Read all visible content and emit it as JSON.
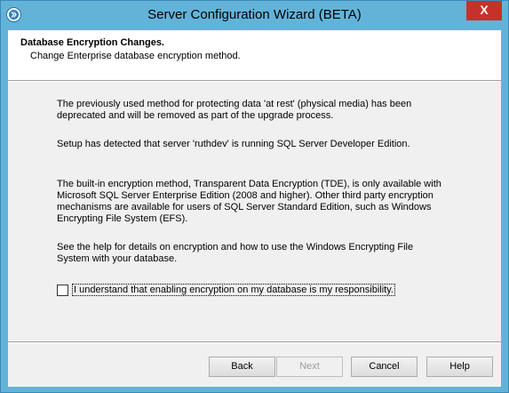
{
  "window": {
    "title": "Server Configuration Wizard (BETA)",
    "close_glyph": "X"
  },
  "header": {
    "title": "Database Encryption Changes.",
    "subtitle": "Change Enterprise database encryption method."
  },
  "body": {
    "paragraph1": "The previously used method for protecting data 'at rest' (physical media) has been deprecated and will be removed as part of the upgrade process.",
    "paragraph2": "Setup has detected that server 'ruthdev'  is running SQL Server Developer Edition.",
    "paragraph3": "The built-in encryption method, Transparent Data Encryption (TDE), is only available with Microsoft SQL Server Enterprise Edition (2008 and higher).  Other third party encryption mechanisms are available for users of SQL Server Standard Edition, such as Windows Encrypting File System (EFS).",
    "paragraph4": "See the help for details on encryption and how to use the Windows Encrypting File System with your database.",
    "checkbox_label": "I understand that enabling encryption on my database is my responsibility.",
    "checkbox_checked": false
  },
  "buttons": {
    "back": "Back",
    "next": "Next",
    "cancel": "Cancel",
    "help": "Help"
  },
  "colors": {
    "titlebar": "#63b3d9",
    "close": "#c7312b",
    "dialog_bg": "#f0f0f0"
  },
  "icons": {
    "app": "wizard-app-icon",
    "close": "close-icon"
  }
}
